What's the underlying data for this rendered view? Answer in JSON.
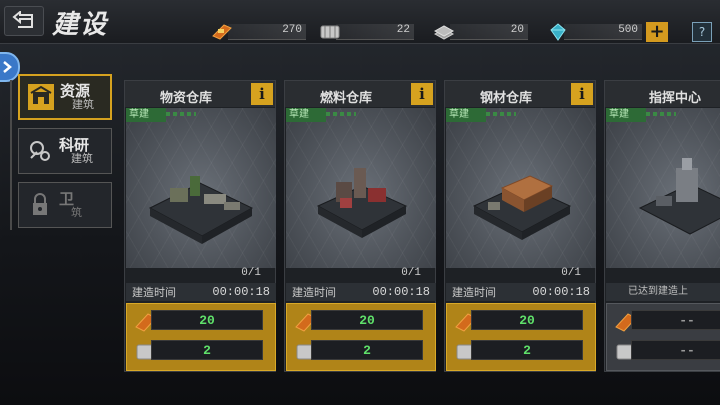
{
  "header": {
    "title": "建设",
    "resources": [
      {
        "icon": "ammo-icon",
        "value": "270"
      },
      {
        "icon": "fuel-icon",
        "value": "22"
      },
      {
        "icon": "steel-icon",
        "value": "20"
      },
      {
        "icon": "crystal-icon",
        "value": "500"
      }
    ],
    "plus_label": "+",
    "help_label": "?"
  },
  "categories": [
    {
      "main": "资源",
      "sub": "建筑",
      "active": true
    },
    {
      "main": "科研",
      "sub": "建筑",
      "active": false
    },
    {
      "main": "卫",
      "sub": "筑",
      "active": false
    }
  ],
  "cards": [
    {
      "name": "物资仓库",
      "badge": "草建",
      "count": "0/1",
      "time_label": "建造时间",
      "time": "00:00:18",
      "cost_a": "20",
      "cost_b": "2"
    },
    {
      "name": "燃料仓库",
      "badge": "草建",
      "count": "0/1",
      "time_label": "建造时间",
      "time": "00:00:18",
      "cost_a": "20",
      "cost_b": "2"
    },
    {
      "name": "钢材仓库",
      "badge": "草建",
      "count": "0/1",
      "time_label": "建造时间",
      "time": "00:00:18",
      "cost_a": "20",
      "cost_b": "2"
    },
    {
      "name": "指挥中心",
      "badge": "草建",
      "note": "已达到建造上",
      "cost_a": "--",
      "cost_b": "--"
    }
  ],
  "info_label": "i",
  "colors": {
    "accent": "#d6a21f",
    "cost_value": "#5fe06a",
    "badge": "#2d6a36"
  }
}
